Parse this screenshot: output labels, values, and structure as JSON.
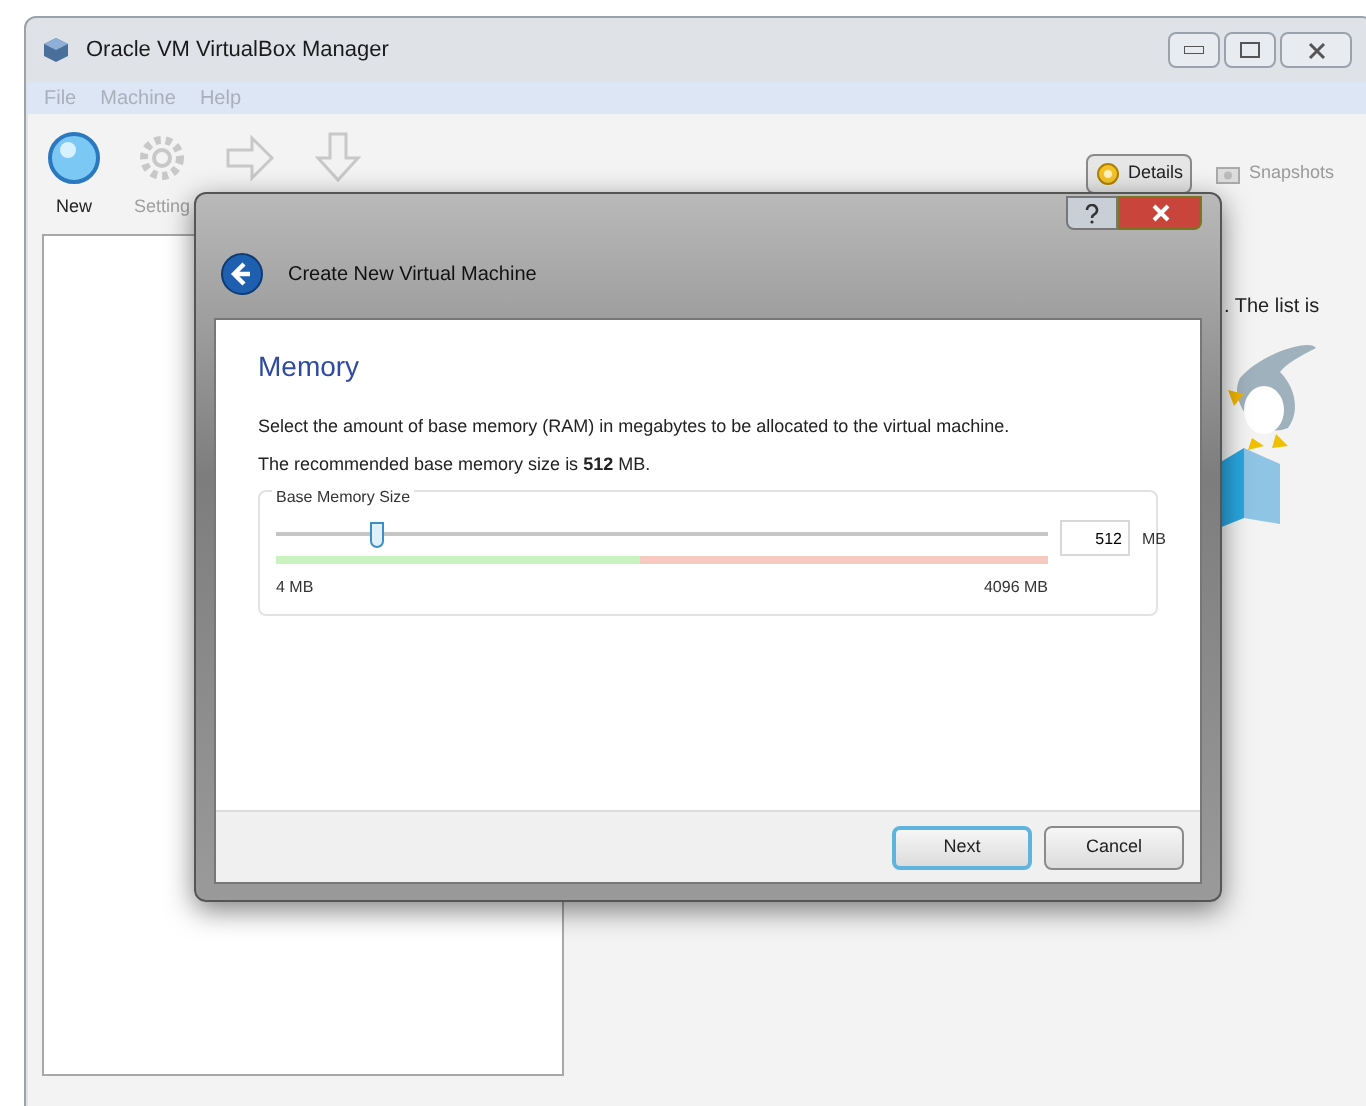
{
  "window": {
    "title": "Oracle VM VirtualBox Manager"
  },
  "menu": [
    {
      "label": "File"
    },
    {
      "label": "Machine"
    },
    {
      "label": "Help"
    }
  ],
  "toolbar": [
    {
      "kind": "new",
      "label": "New",
      "disabled": false
    },
    {
      "kind": "settings",
      "label": "Setting",
      "disabled": true
    },
    {
      "kind": "start",
      "disabled": true
    },
    {
      "kind": "discard",
      "disabled": true
    }
  ],
  "view_tabs": [
    {
      "label": "Details",
      "selected": true
    },
    {
      "label": "Snapshots",
      "selected": false
    }
  ],
  "welcome_text": ". The list is",
  "dialog": {
    "title": "Create New Virtual Machine",
    "heading": "Memory",
    "description": "Select the amount of base memory (RAM) in megabytes to be allocated to the virtual machine.",
    "recommendation": "The recommended base memory size is **512** MB.",
    "group_label": "Base Memory Size",
    "slider": {
      "level": 0.13
    },
    "value": "512",
    "unit": "MB",
    "min_label": "4 MB",
    "max_label": "4096 MB",
    "buttons": [
      {
        "label": "Next",
        "default": true
      },
      {
        "label": "Cancel",
        "default": false
      }
    ]
  }
}
